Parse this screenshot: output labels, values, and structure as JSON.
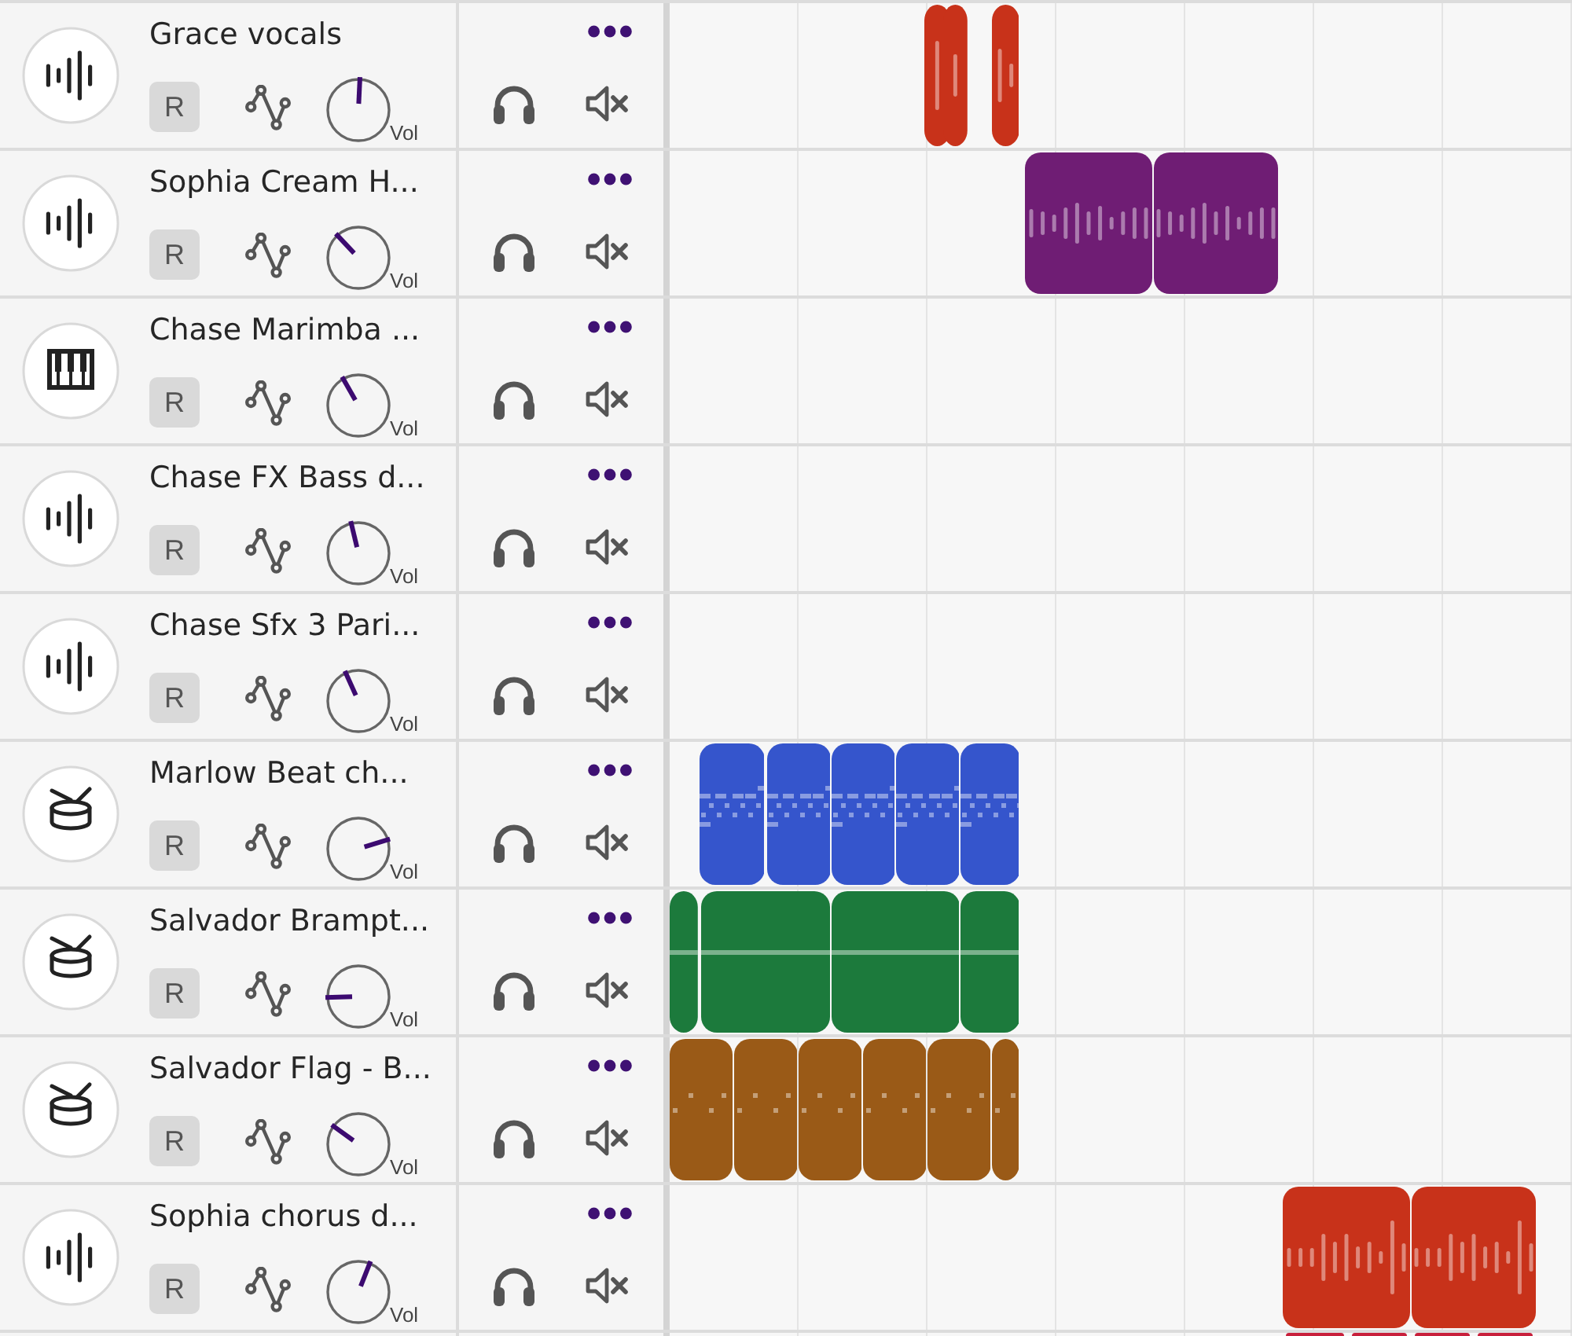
{
  "tracks": [
    {
      "name": "Grace vocals",
      "kind": "audio",
      "record_button": "R",
      "volume": {
        "label": "Vol",
        "level": 0.51
      },
      "color": "#c8321a",
      "clips": [
        {
          "kind": "waveform"
        },
        {
          "kind": "waveform"
        },
        {
          "kind": "waveform"
        }
      ]
    },
    {
      "name": "Sophia Cream H...",
      "kind": "audio",
      "record_button": "R",
      "volume": {
        "label": "Vol",
        "level": 0.34
      },
      "color": "#6f1d74",
      "clips": [
        {
          "kind": "waveform"
        },
        {
          "kind": "waveform"
        }
      ]
    },
    {
      "name": "Chase Marimba ...",
      "kind": "keys",
      "record_button": "R",
      "volume": {
        "label": "Vol",
        "level": 0.39
      }
    },
    {
      "name": "Chase FX Bass d...",
      "kind": "audio",
      "record_button": "R",
      "volume": {
        "label": "Vol",
        "level": 0.45
      }
    },
    {
      "name": "Chase Sfx 3 Pari...",
      "kind": "audio",
      "record_button": "R",
      "volume": {
        "label": "Vol",
        "level": 0.41
      }
    },
    {
      "name": "Marlow Beat ch...",
      "kind": "drums",
      "record_button": "R",
      "volume": {
        "label": "Vol",
        "level": 0.77
      },
      "color": "#3555cc",
      "clips": [
        {
          "kind": "hits"
        },
        {
          "kind": "hits"
        },
        {
          "kind": "hits"
        },
        {
          "kind": "hits"
        },
        {
          "kind": "hits"
        }
      ]
    },
    {
      "name": "Salvador Brampt...",
      "kind": "drums",
      "record_button": "R",
      "volume": {
        "label": "Vol",
        "level": 0.16
      },
      "color": "#1c7a3c",
      "clips": [
        {
          "kind": "line"
        },
        {
          "kind": "line"
        },
        {
          "kind": "line"
        },
        {
          "kind": "line"
        }
      ]
    },
    {
      "name": "Salvador Flag - B...",
      "kind": "drums",
      "record_button": "R",
      "volume": {
        "label": "Vol",
        "level": 0.3
      },
      "color": "#9a5a17",
      "clips": [
        {
          "kind": "dots"
        },
        {
          "kind": "dots"
        },
        {
          "kind": "dots"
        },
        {
          "kind": "dots"
        },
        {
          "kind": "dots"
        },
        {
          "kind": "dots"
        }
      ]
    },
    {
      "name": "Sophia chorus d...",
      "kind": "audio",
      "record_button": "R",
      "volume": {
        "label": "Vol",
        "level": 0.58
      },
      "color": "#c8321a",
      "clips": [
        {
          "kind": "waveform"
        },
        {
          "kind": "waveform"
        }
      ]
    }
  ],
  "cut_off_track": {
    "color": "#c8203c"
  }
}
